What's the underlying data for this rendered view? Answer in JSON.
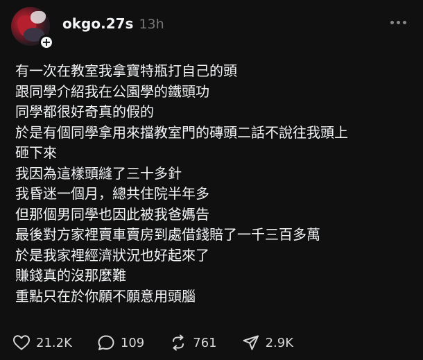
{
  "post": {
    "username": "okgo.27s",
    "timestamp": "13h",
    "lines": [
      "有一次在教室我拿寶特瓶打自己的頭",
      "跟同學介紹我在公園學的鐵頭功",
      "同學都很好奇真的假的",
      "於是有個同學拿用來擋教室門的磚頭二話不說往我頭上",
      "砸下來",
      "我因為這樣頭縫了三十多針",
      "我昏迷一個月，總共住院半年多",
      "但那個男同學也因此被我爸媽告",
      "最後對方家裡賣車賣房到處借錢賠了一千三百多萬",
      "於是我家裡經濟狀況也好起來了",
      "賺錢真的沒那麼難",
      "重點只在於你願不願意用頭腦"
    ],
    "actions": {
      "likes": "21.2K",
      "replies": "109",
      "reposts": "761",
      "shares": "2.9K"
    }
  },
  "icons": {
    "avatar_badge": "plus-icon",
    "menu": "more-icon",
    "like": "heart-icon",
    "reply": "comment-icon",
    "repost": "repost-icon",
    "share": "send-icon"
  },
  "colors": {
    "background": "#101010",
    "text": "#f3f5f7",
    "muted": "#777777"
  }
}
